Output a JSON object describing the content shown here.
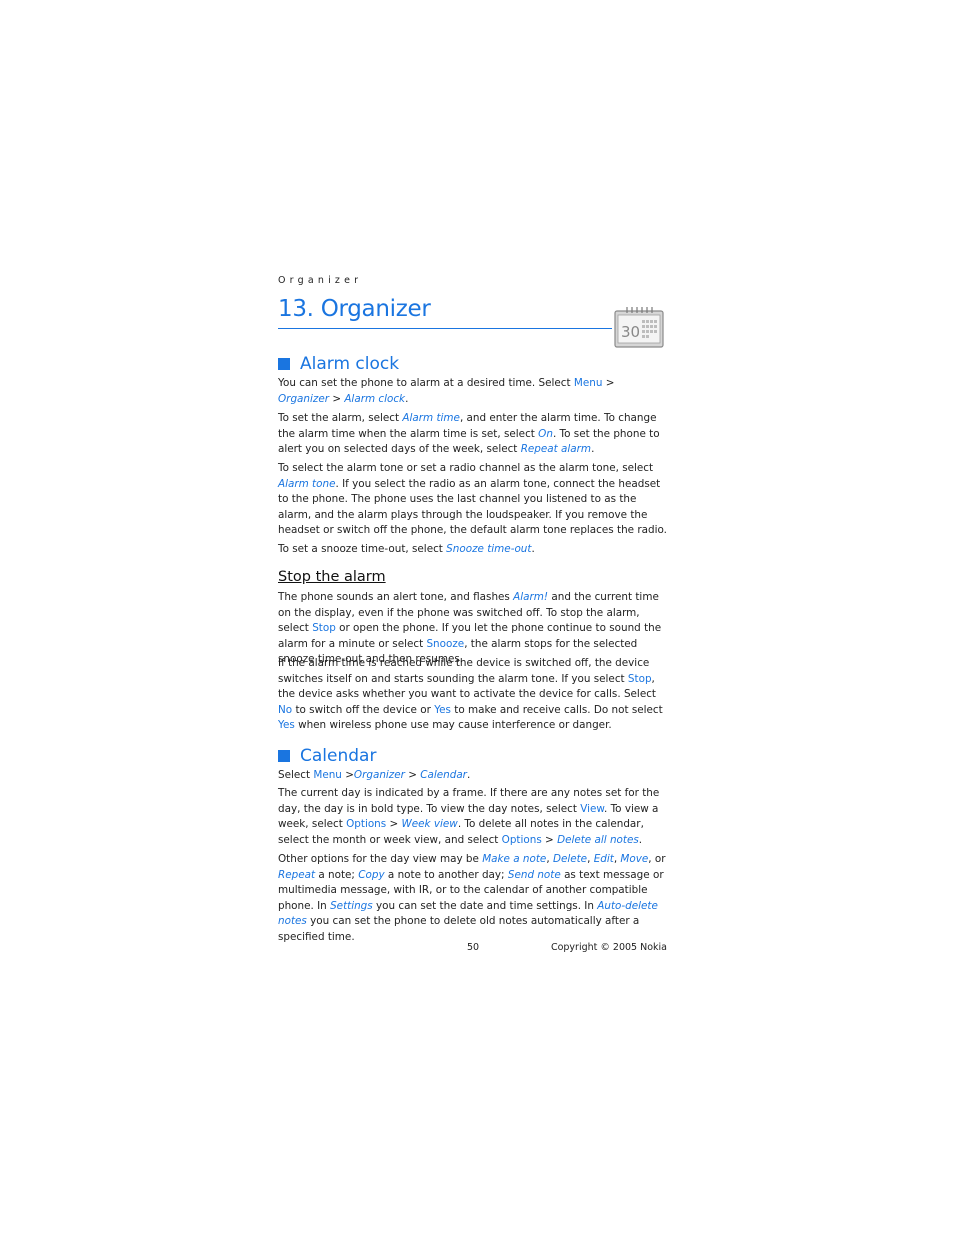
{
  "running_head": "Organizer",
  "chapter": {
    "title": "13. Organizer",
    "icon": "calendar-icon",
    "icon_label": "30"
  },
  "sections": {
    "alarm_clock": {
      "heading": "Alarm clock",
      "p1": {
        "t1": "You can set the phone to alarm at a desired time. Select ",
        "menu": "Menu",
        "sep1": " > ",
        "organizer": "Organizer",
        "sep2": " > ",
        "alarm_clock": "Alarm clock",
        "end": "."
      },
      "p2": {
        "t1": "To set the alarm, select ",
        "alarm_time": "Alarm time",
        "t2": ", and enter the alarm time. To change the alarm time when the alarm time is set, select ",
        "on": "On",
        "t3": ". To set the phone to alert you on selected days of the week, select ",
        "repeat_alarm": "Repeat alarm",
        "end": "."
      },
      "p3": {
        "t1": "To select the alarm tone or set a radio channel as the alarm tone, select ",
        "alarm_tone": "Alarm tone",
        "t2": ". If you select the radio as an alarm tone, connect the headset to the phone. The phone uses the last channel you listened to as the alarm, and the alarm plays through the loudspeaker. If you remove the headset or switch off the phone, the default alarm tone replaces the radio."
      },
      "p4": {
        "t1": "To set a snooze time-out, select ",
        "snooze_timeout": "Snooze time-out",
        "end": "."
      }
    },
    "stop_alarm": {
      "heading": "Stop the alarm",
      "p1": {
        "t1": "The phone sounds an alert tone, and flashes ",
        "alarm": "Alarm!",
        "t2": " and the current time on the display, even if the phone was switched off. To stop the alarm, select ",
        "stop": "Stop",
        "t3": " or open the phone. If you let the phone continue to sound the alarm for a minute or select ",
        "snooze": "Snooze",
        "t4": ", the alarm stops for the selected snooze time-out and then resumes."
      },
      "p2": {
        "t1": "If the alarm time is reached while the device is switched off, the device switches itself on and starts sounding the alarm tone. If you select ",
        "stop": "Stop",
        "t2": ", the device asks whether you want to activate the device for calls. Select ",
        "no": "No",
        "t3": " to switch off the device or ",
        "yes1": "Yes",
        "t4": " to make and receive calls. Do not select ",
        "yes2": "Yes",
        "t5": " when wireless phone use may cause interference or danger."
      }
    },
    "calendar": {
      "heading": "Calendar",
      "p1": {
        "t1": "Select ",
        "menu": "Menu",
        "sep1": " >",
        "organizer": "Organizer",
        "sep2": " > ",
        "calendar": "Calendar",
        "end": "."
      },
      "p2": {
        "t1": "The current day is indicated by a frame. If there are any notes set for the day, the day is in bold type. To view the day notes, select ",
        "view": "View",
        "t2": ". To view a week, select ",
        "options1": "Options",
        "sep1": " > ",
        "week_view": "Week view",
        "t3": ". To delete all notes in the calendar, select the month or week view, and select ",
        "options2": "Options",
        "sep2": " > ",
        "delete_all": "Delete all notes",
        "end": "."
      },
      "p3": {
        "t1": "Other options for the day view may be ",
        "make_note": "Make a note",
        "c1": ", ",
        "delete": "Delete",
        "c2": ", ",
        "edit": "Edit",
        "c3": ", ",
        "move": "Move",
        "c4": ", or ",
        "repeat": "Repeat",
        "t2": " a note; ",
        "copy": "Copy",
        "t3": " a note to another day; ",
        "send_note": "Send note",
        "t4": " as text message or multimedia message, with IR, or to the calendar of another compatible phone. In ",
        "settings": "Settings",
        "t5": " you can set the date and time settings. In ",
        "auto_delete": "Auto-delete notes",
        "t6": " you can set the phone to delete old notes automatically after a specified time."
      }
    }
  },
  "footer": {
    "page_number": "50",
    "copyright": "Copyright © 2005 Nokia"
  },
  "colors": {
    "accent": "#1a75e0",
    "text": "#222222"
  }
}
